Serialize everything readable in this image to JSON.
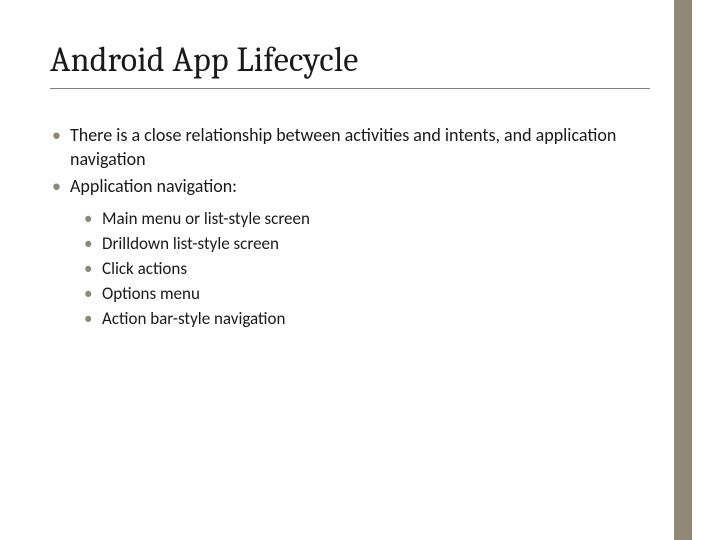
{
  "slide": {
    "title": "Android App Lifecycle",
    "bullets": [
      "There is a close relationship between activities and intents, and application navigation",
      "Application navigation:"
    ],
    "sub_bullets": [
      "Main menu or list-style screen",
      "Drilldown list-style screen",
      "Click actions",
      "Options menu",
      "Action bar-style navigation"
    ]
  }
}
